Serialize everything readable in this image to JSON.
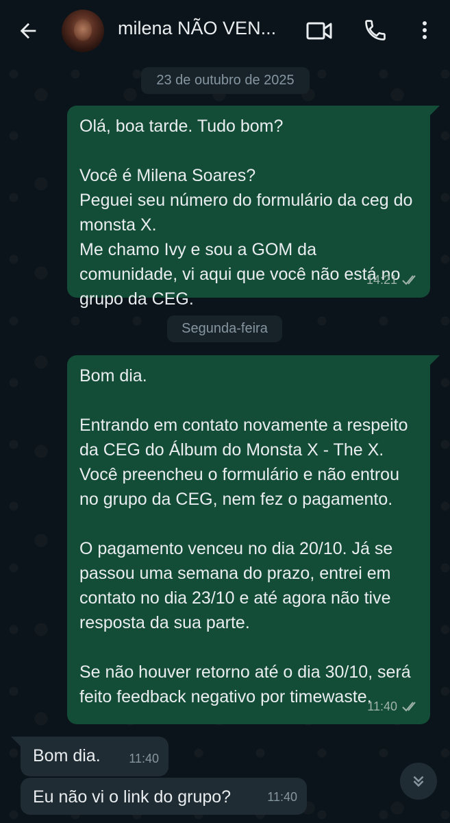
{
  "header": {
    "title": "milena NÃO VEN...",
    "icons": [
      "back-arrow-icon",
      "video-call-icon",
      "phone-icon",
      "more-options-icon"
    ]
  },
  "chat": {
    "date_chip_1": "23 de outubro de 2025",
    "date_chip_2": "Segunda-feira",
    "messages": [
      {
        "direction": "outgoing",
        "text": "Olá, boa tarde. Tudo bom?\n\nVocê é Milena Soares?\nPeguei seu número do formulário da ceg do monsta X.\nMe chamo Ivy e sou a GOM da comunidade, vi aqui que você não está no grupo da CEG.",
        "time": "14:21",
        "status": "read-ticks"
      },
      {
        "direction": "outgoing",
        "text": "Bom dia.\n\nEntrando em contato novamente a respeito da CEG do Álbum do Monsta X - The X. Você preencheu o formulário e não entrou no grupo da CEG, nem fez o pagamento.\n\nO pagamento venceu no dia 20/10. Já se passou uma semana do prazo, entrei em contato no dia 23/10 e até agora não tive resposta da sua parte.\n\nSe não houver retorno até o dia 30/10, será feito feedback negativo por timewaste.",
        "time": "11:40",
        "status": "read-ticks"
      },
      {
        "direction": "incoming",
        "text": "Bom dia.",
        "time": "11:40"
      },
      {
        "direction": "incoming",
        "text": "Eu não vi o link do grupo?",
        "time": "11:40"
      }
    ]
  },
  "colors": {
    "background": "#0b141a",
    "outgoing_bubble": "#144d37",
    "incoming_bubble": "#202c33",
    "text": "#e9edef",
    "meta": "#8696a0"
  }
}
